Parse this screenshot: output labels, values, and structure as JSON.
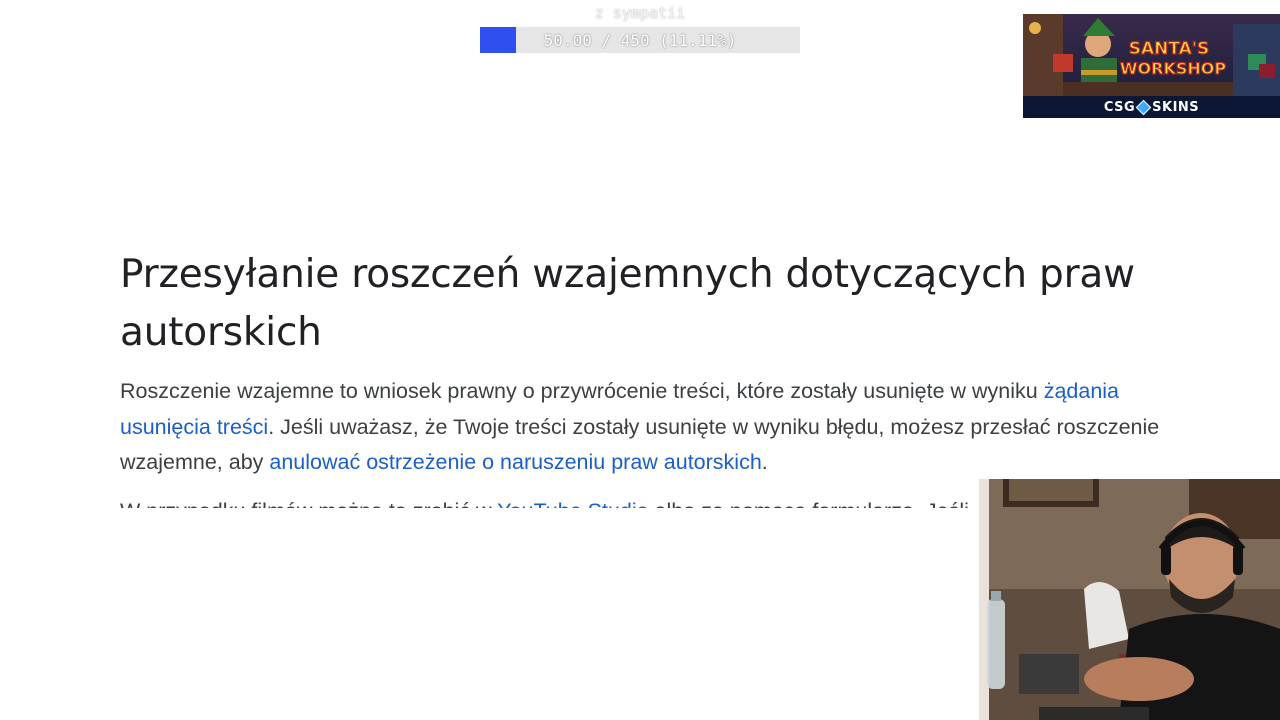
{
  "overlay": {
    "goal_label": "z sympatii",
    "goal_progress_text": "50.00 / 450 (11.11%)",
    "goal_fraction": 0.1111,
    "goal_fill_color": "#2f4ff0"
  },
  "sponsor": {
    "title_line1": "SANTA'S",
    "title_line2": "WORKSHOP",
    "brand_left": "CSG",
    "brand_right": "SKINS"
  },
  "article": {
    "heading": "Przesyłanie roszczeń wzajemnych dotyczących praw autorskich",
    "p1_text1": "Roszczenie wzajemne to wniosek prawny o przywrócenie treści, które zostały usunięte w wyniku ",
    "p1_link1": "żądania usunięcia treści",
    "p1_text2": ". Jeśli uważasz, że Twoje treści zostały usunięte w wyniku błędu, możesz przesłać roszczenie wzajemne, aby ",
    "p1_link2": "anulować ostrzeżenie o naruszeniu praw autorskich",
    "p1_text3": ".",
    "p2_text1": "W przypadku filmów można to zrobić w ",
    "p2_link1": "YouTube Studio",
    "p2_text2": " albo za pomocą formularza. Jeśli"
  },
  "colors": {
    "link": "#1a5fc9",
    "heading": "#202124",
    "body_text": "#3c4043"
  }
}
